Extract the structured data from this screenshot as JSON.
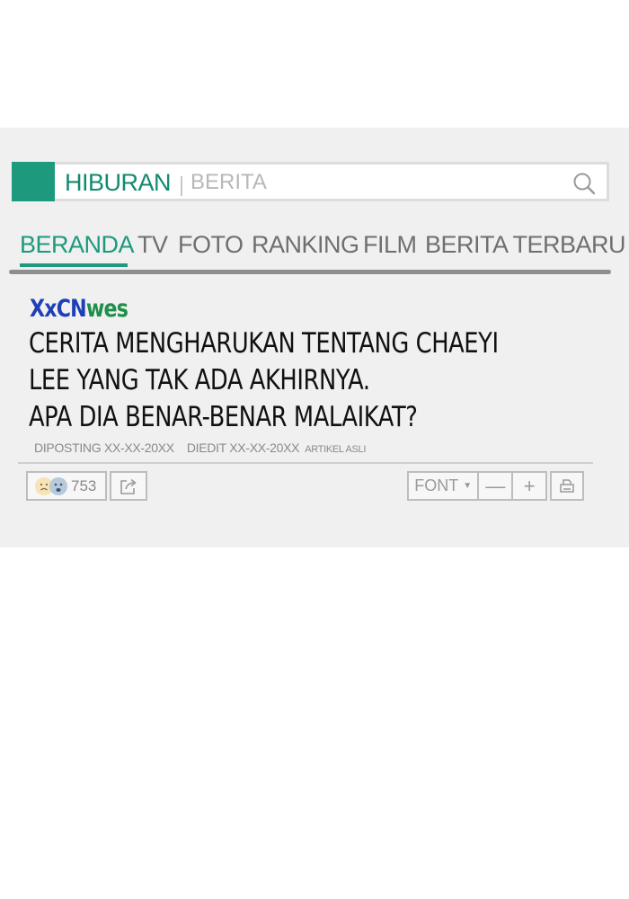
{
  "header": {
    "section": "HIBURAN",
    "divider": "|",
    "search_placeholder": "BERITA"
  },
  "nav": {
    "items": [
      {
        "label": "BERANDA",
        "active": true
      },
      {
        "label": "TV",
        "active": false
      },
      {
        "label": "FOTO",
        "active": false
      },
      {
        "label": "RANKING",
        "active": false
      },
      {
        "label": "FILM",
        "active": false
      },
      {
        "label": "BERITA TERBARU",
        "active": false
      }
    ]
  },
  "article": {
    "logo_part1": "XxCN",
    "logo_part2": "wes",
    "headline_lines": [
      "CERITA MENGHARUKAN TENTANG CHAEYI",
      "LEE YANG TAK ADA AKHIRNYA.",
      "APA DIA BENAR-BENAR MALAIKAT?"
    ],
    "posted": "DIPOSTING XX-XX-20XX",
    "edited": "DIEDIT XX-XX-20XX",
    "original": "ARTIKEL ASLI"
  },
  "toolbar": {
    "reaction_count": "753",
    "font_label": "FONT",
    "font_caret": "▼",
    "minus_label": "—",
    "plus_label": "+"
  },
  "colors": {
    "accent": "#1d9a7e",
    "panel_bg": "#f0f0f0",
    "logo_blue": "#1f3fb8",
    "logo_green": "#1e8f49"
  },
  "icons": {
    "search": "search-icon",
    "share": "share-icon",
    "print": "print-icon"
  }
}
